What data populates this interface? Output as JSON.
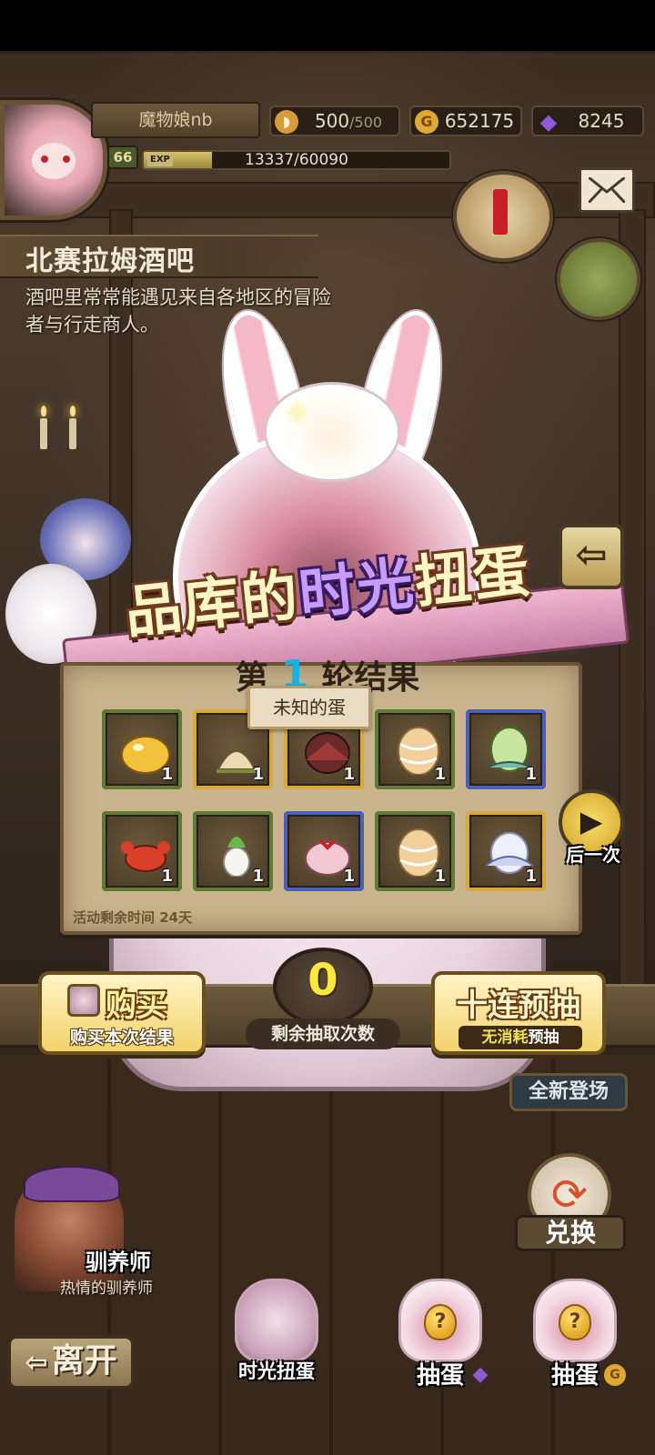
{
  "player": {
    "name": "魔物娘nb",
    "level": "66",
    "exp_tag": "EXP",
    "exp_text": "13337/60090",
    "exp_fraction": 0.222
  },
  "resources": {
    "stamina_current": "500",
    "stamina_max": "/500",
    "gold": "652175",
    "gold_icon": "G",
    "gems": "8245"
  },
  "location": {
    "title": "北赛拉姆酒吧",
    "description": "酒吧里常常能遇见来自各地区的冒险者与行走商人。"
  },
  "event": {
    "title_pre": "品库的",
    "title_highlight": "时光",
    "title_post": "扭蛋",
    "round_prefix": "第",
    "round_number": "1",
    "round_suffix": "轮结果",
    "tooltip": "未知的蛋",
    "remaining_time": "活动剩余时间  24天",
    "items": [
      {
        "name": "golden-slime-egg",
        "count": "1",
        "frame": "green"
      },
      {
        "name": "seed-bag",
        "count": "1",
        "frame": "gold"
      },
      {
        "name": "dark-wing-egg",
        "count": "1",
        "frame": "gold"
      },
      {
        "name": "striped-egg",
        "count": "1",
        "frame": "green"
      },
      {
        "name": "green-dragon-egg",
        "count": "1",
        "frame": "blue"
      },
      {
        "name": "red-crab",
        "count": "1",
        "frame": "green"
      },
      {
        "name": "white-radish",
        "count": "1",
        "frame": "green"
      },
      {
        "name": "pink-gift-bag",
        "count": "1",
        "frame": "blue"
      },
      {
        "name": "striped-egg",
        "count": "1",
        "frame": "green"
      },
      {
        "name": "pearl-shell-egg",
        "count": "1",
        "frame": "gold"
      }
    ],
    "next_label": "后一次",
    "draws_remaining": "0",
    "draws_label": "剩余抽取次数"
  },
  "actions": {
    "buy_label": "购买",
    "buy_sub": "购买本次结果",
    "ten_label": "十连预抽",
    "ten_sub_free": "无消耗",
    "ten_sub_rest": "预抽",
    "new_badge": "全新登场"
  },
  "npc": {
    "name": "驯养师",
    "title": "热情的驯养师"
  },
  "nav": {
    "exchange": "兑换",
    "leave": "离开",
    "leave_arrow": "⇦",
    "time_gacha": "时光扭蛋",
    "draw_gem": "抽蛋",
    "draw_gold": "抽蛋",
    "gold_icon": "G"
  },
  "colors": {
    "accent_gold": "#f2d36a",
    "round_number": "#1ab0e0",
    "draw_count": "#ffe83a"
  }
}
